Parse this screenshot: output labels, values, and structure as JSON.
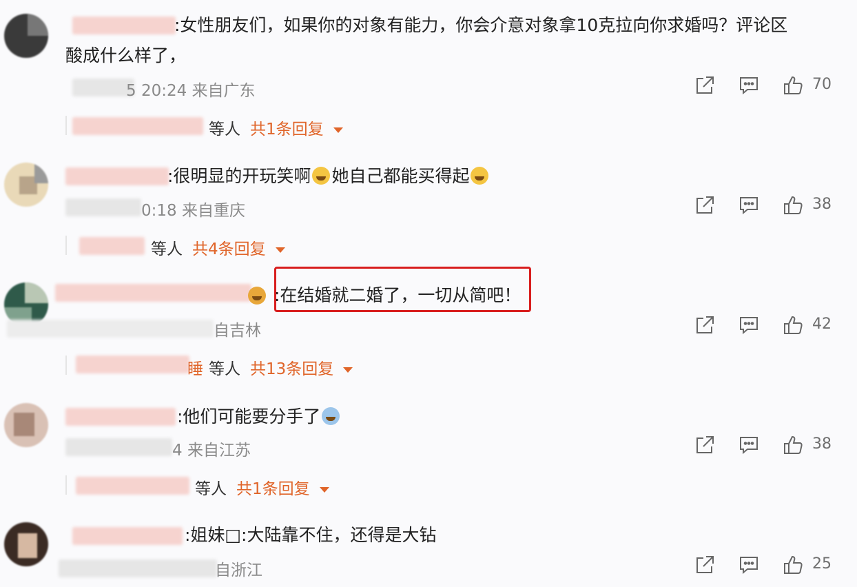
{
  "comments": [
    {
      "text_line1": ":女性朋友们，如果你的对象有能力，你会介意对象拿10克拉向你求婚吗？评论区",
      "text_line2": "酸成什么样了，",
      "time_partial": "5 20:24 来自广东",
      "like_count": "70",
      "reply_suffix": "等人",
      "reply_total": "共1条回复"
    },
    {
      "text": ":很明显的开玩笑啊",
      "text_tail": "她自己都能买得起",
      "time_partial": "0:18 来自重庆",
      "like_count": "38",
      "reply_suffix": "等人",
      "reply_total": "共4条回复"
    },
    {
      "text": ":在结婚就二婚了，一切从简吧！",
      "time_partial": "自吉林",
      "like_count": "42",
      "reply_suffix": "等人",
      "reply_total": "共13条回复",
      "reply_name_partial": "睡"
    },
    {
      "text": ":他们可能要分手了",
      "time_partial": "4 来自江苏",
      "like_count": "38",
      "reply_suffix": "等人",
      "reply_total": "共1条回复"
    },
    {
      "text": ":姐妹□:大陆靠不住，还得是大钻",
      "time_partial": "自浙江",
      "like_count": "25"
    }
  ],
  "icons": {
    "share": "share-icon",
    "comment": "comment-icon",
    "like": "thumbs-up-icon",
    "expand": "caret-down-icon"
  },
  "colors": {
    "accent": "#e0652a",
    "highlight": "#d81e1e",
    "meta_text": "#8a8a8a"
  }
}
